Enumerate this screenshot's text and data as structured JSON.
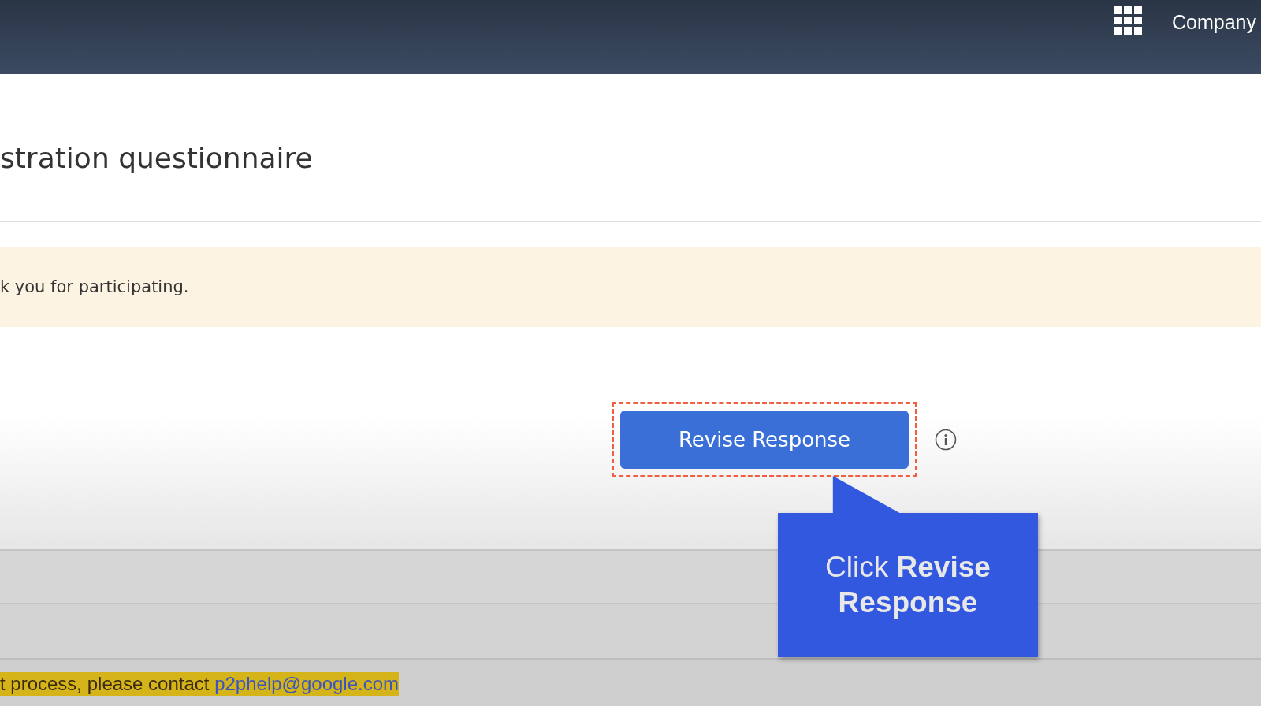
{
  "header": {
    "company": "Company"
  },
  "page_title": "stration questionnaire",
  "banner": {
    "message": "k you for participating."
  },
  "action": {
    "button": "Revise Response",
    "highlighted": true
  },
  "callout": {
    "text": "Click **Revise Response**"
  },
  "footer": {
    "text": "t process, please contact ",
    "link": "p2phelp@google.com"
  }
}
